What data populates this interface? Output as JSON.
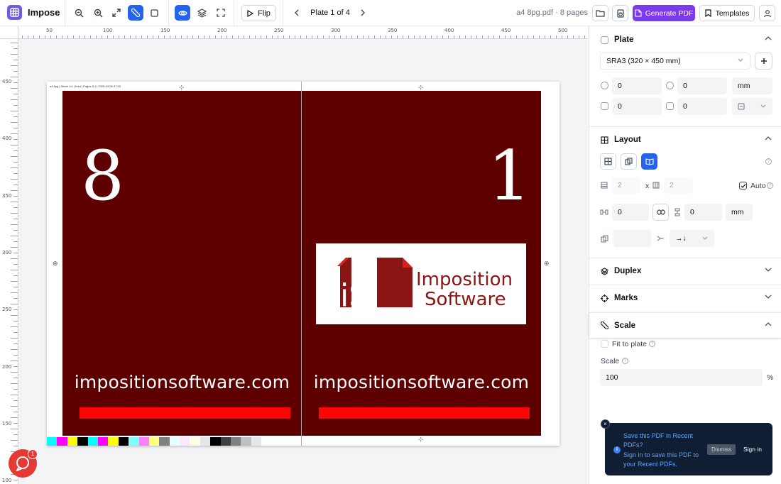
{
  "app": {
    "name": "Impose"
  },
  "toolbar": {
    "flip_label": "Flip",
    "plate_nav": "Plate 1 of 4",
    "file_info": "a4 8pg.pdf · 8 pages",
    "generate_label": "Generate PDF",
    "templates_label": "Templates"
  },
  "ruler": {
    "top": [
      "50",
      "100",
      "150",
      "200",
      "250",
      "300",
      "350",
      "400",
      "450",
      "500"
    ],
    "left": [
      "450",
      "400",
      "350",
      "300",
      "250",
      "200",
      "150",
      "100"
    ]
  },
  "sheet": {
    "slug": "a4 8pg | Sheet 1/4 | front | Pages 8,1 | 2026-04-06 07:23",
    "left_page": {
      "number": "8",
      "url": "impositionsoftware.com"
    },
    "right_page": {
      "number": "1",
      "url": "impositionsoftware.com",
      "logo_line1": "Imposition",
      "logo_line2": "Software",
      "logo_mark": "iS"
    },
    "colorbar": [
      "#00ffff",
      "#ff00ff",
      "#ffff00",
      "#000000",
      "#00ffff",
      "#ff00ff",
      "#ffff00",
      "#000000",
      "#80ffff",
      "#ff80ff",
      "#ffff80",
      "#808080",
      "#e6ffff",
      "#ffe6ff",
      "#ffffe6",
      "#e6e6e6",
      "#000000",
      "#404040",
      "#808080",
      "#bfbfbf",
      "#e6e6e6"
    ],
    "colors": {
      "page_bg": "#5e0000",
      "bar": "#fd0505",
      "logo_red": "#8b1414"
    }
  },
  "panel": {
    "plate": {
      "title": "Plate",
      "size_select": "SRA3 (320 × 450 mm)",
      "offset_x": "0",
      "offset_y": "0",
      "unit": "mm",
      "bleed_x": "0",
      "bleed_y": "0"
    },
    "layout": {
      "title": "Layout",
      "rows": "2",
      "x_sep": "x",
      "cols": "2",
      "auto_label": "Auto",
      "gap_h": "0",
      "gap_v": "0",
      "unit": "mm",
      "order": "→↓"
    },
    "duplex": {
      "title": "Duplex"
    },
    "marks": {
      "title": "Marks"
    },
    "scale": {
      "title": "Scale",
      "fit_label": "Fit to plate",
      "scale_label": "Scale",
      "value": "100",
      "unit": "%"
    }
  },
  "toast": {
    "title": "Save this PDF in Recent PDFs?",
    "body": "Sign in to save this PDF to your Recent PDFs.",
    "dismiss": "Dismiss",
    "signin": "Sign in",
    "close": "×"
  },
  "chat": {
    "badge": "1"
  }
}
